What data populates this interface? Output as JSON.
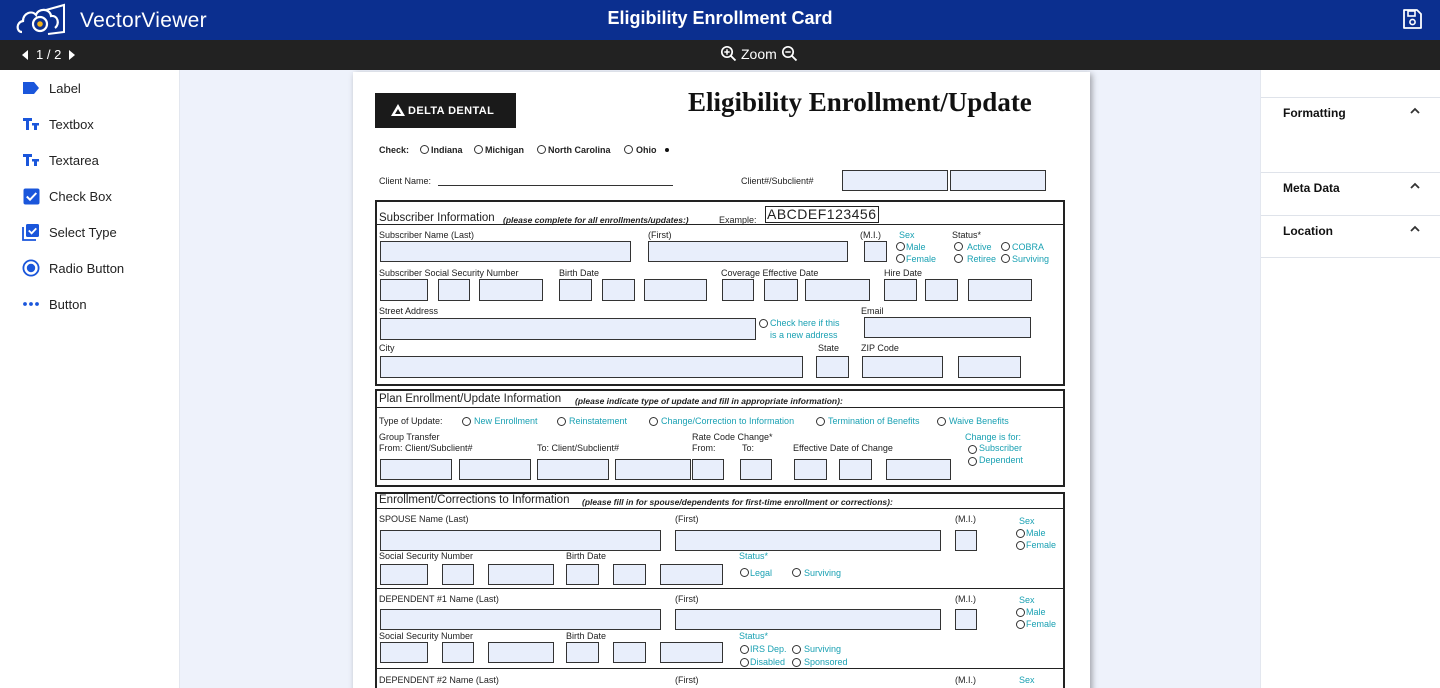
{
  "app": {
    "brand": "VectorViewer",
    "title": "Eligibility Enrollment Card"
  },
  "pager": {
    "label": "1 / 2"
  },
  "zoom": {
    "label": "Zoom"
  },
  "tools": [
    {
      "label": "Label",
      "icon": "label-icon"
    },
    {
      "label": "Textbox",
      "icon": "textbox-icon"
    },
    {
      "label": "Textarea",
      "icon": "textarea-icon"
    },
    {
      "label": "Check Box",
      "icon": "checkbox-icon"
    },
    {
      "label": "Select Type",
      "icon": "select-type-icon"
    },
    {
      "label": "Radio Button",
      "icon": "radio-button-icon"
    },
    {
      "label": "Button",
      "icon": "more-dots-icon"
    }
  ],
  "panels": [
    "Formatting",
    "Meta Data",
    "Location"
  ],
  "colors": {
    "header": "#0b2f8f",
    "subbar": "#222222",
    "accent": "#1a56db",
    "field": "#e8eefb",
    "teal": "#1aa1b3"
  },
  "form": {
    "logo_text": "DELTA DENTAL",
    "heading": "Eligibility  Enrollment/Update",
    "check_label": "Check:",
    "states": [
      "Indiana",
      "Michigan",
      "North Carolina",
      "Ohio"
    ],
    "client_name": "Client Name:",
    "client_sub": "Client#/Subclient#",
    "sub": {
      "title": "Subscriber Information",
      "note": "(please complete for all enrollments/updates:)",
      "example": "Example:",
      "example_value": "ABCDEF123456",
      "name_last": "Subscriber Name (Last)",
      "first": "(First)",
      "mi": "(M.I.)",
      "sex": "Sex",
      "male": "Male",
      "female": "Female",
      "status": "Status*",
      "active": "Active",
      "cobra": "COBRA",
      "retiree": "Retiree",
      "surviving": "Surviving",
      "ssn": "Subscriber Social Security Number",
      "birth": "Birth Date",
      "coverage": "Coverage Effective Date",
      "hire": "Hire Date",
      "street": "Street Address",
      "check_new_1": "Check here if this",
      "check_new_2": "is a new address",
      "email": "Email",
      "city": "City",
      "state": "State",
      "zip": "ZIP Code"
    },
    "plan": {
      "title": "Plan Enrollment/Update Information",
      "note": "(please indicate type of update and fill in appropriate information):",
      "type_label": "Type of Update:",
      "types": [
        "New Enrollment",
        "Reinstatement",
        "Change/Correction to Information",
        "Termination of Benefits",
        "Waive Benefits"
      ],
      "group_transfer": "Group Transfer",
      "from_client": "From: Client/Subclient#",
      "to_client": "To: Client/Subclient#",
      "rate_code": "Rate Code Change*",
      "from": "From:",
      "to": "To:",
      "eff_change": "Effective Date of Change",
      "change_for": "Change is for:",
      "subscriber": "Subscriber",
      "dependent": "Dependent"
    },
    "enroll": {
      "title": "Enrollment/Corrections to Information",
      "note": "(please fill in for spouse/dependents for first-time enrollment or corrections):",
      "spouse_name": "SPOUSE Name (Last)",
      "first": "(First)",
      "mi": "(M.I.)",
      "sex": "Sex",
      "male": "Male",
      "female": "Female",
      "ssn": "Social Security Number",
      "birth": "Birth Date",
      "status": "Status*",
      "legal": "Legal",
      "surviving": "Surviving",
      "dep1_name": "DEPENDENT #1 Name (Last)",
      "irs_dep": "IRS Dep.",
      "disabled": "Disabled",
      "sponsored": "Sponsored",
      "dep2_name": "DEPENDENT #2 Name (Last)"
    }
  }
}
